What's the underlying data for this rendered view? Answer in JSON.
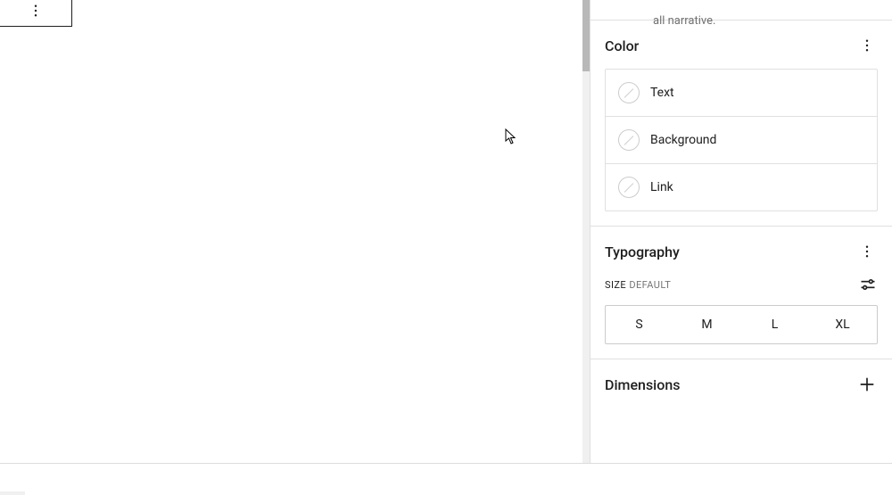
{
  "canvas": {
    "description_fragment": "all narrative."
  },
  "sidebar": {
    "color": {
      "title": "Color",
      "items": [
        {
          "label": "Text"
        },
        {
          "label": "Background"
        },
        {
          "label": "Link"
        }
      ]
    },
    "typography": {
      "title": "Typography",
      "size_label": "SIZE",
      "size_value": "DEFAULT",
      "options": [
        "S",
        "M",
        "L",
        "XL"
      ]
    },
    "dimensions": {
      "title": "Dimensions"
    }
  }
}
